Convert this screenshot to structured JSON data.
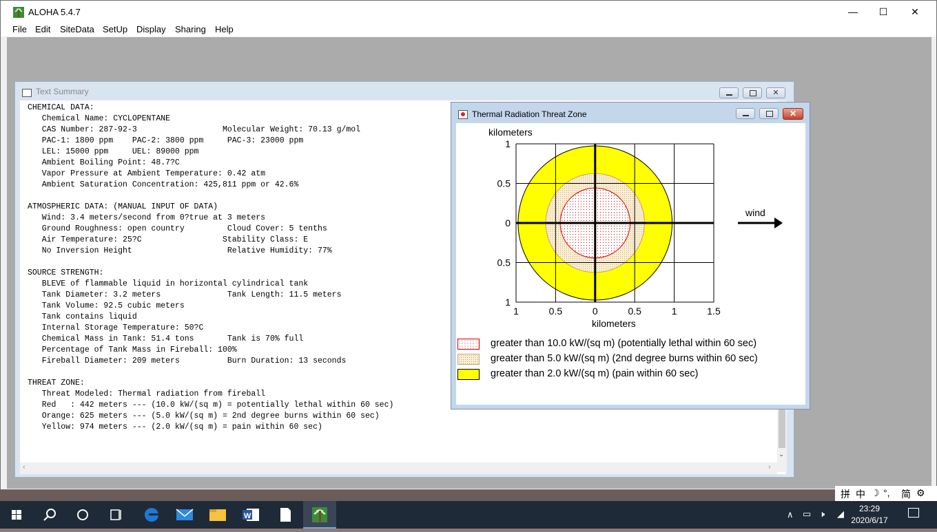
{
  "app": {
    "title": "ALOHA 5.4.7",
    "minimize": "—",
    "maximize": "☐",
    "close": "✕"
  },
  "menu": [
    "File",
    "Edit",
    "SiteData",
    "SetUp",
    "Display",
    "Sharing",
    "Help"
  ],
  "text_summary": {
    "title": "Text Summary",
    "lines": [
      "CHEMICAL DATA:",
      "   Chemical Name: CYCLOPENTANE",
      "   CAS Number: 287-92-3                  Molecular Weight: 70.13 g/mol",
      "   PAC-1: 1800 ppm    PAC-2: 3800 ppm     PAC-3: 23000 ppm",
      "   LEL: 15000 ppm     UEL: 89000 ppm",
      "   Ambient Boiling Point: 48.7?C",
      "   Vapor Pressure at Ambient Temperature: 0.42 atm",
      "   Ambient Saturation Concentration: 425,811 ppm or 42.6%",
      "",
      "ATMOSPHERIC DATA: (MANUAL INPUT OF DATA)",
      "   Wind: 3.4 meters/second from 0?true at 3 meters",
      "   Ground Roughness: open country         Cloud Cover: 5 tenths",
      "   Air Temperature: 25?C                 Stability Class: E",
      "   No Inversion Height                    Relative Humidity: 77%",
      "",
      "SOURCE STRENGTH:",
      "   BLEVE of flammable liquid in horizontal cylindrical tank",
      "   Tank Diameter: 3.2 meters              Tank Length: 11.5 meters",
      "   Tank Volume: 92.5 cubic meters",
      "   Tank contains liquid",
      "   Internal Storage Temperature: 50?C",
      "   Chemical Mass in Tank: 51.4 tons       Tank is 70% full",
      "   Percentage of Tank Mass in Fireball: 100%",
      "   Fireball Diameter: 209 meters          Burn Duration: 13 seconds",
      "",
      "THREAT ZONE:",
      "   Threat Modeled: Thermal radiation from fireball",
      "   Red   : 442 meters --- (10.0 kW/(sq m) = potentially lethal within 60 sec)",
      "   Orange: 625 meters --- (5.0 kW/(sq m) = 2nd degree burns within 60 sec)",
      "   Yellow: 974 meters --- (2.0 kW/(sq m) = pain within 60 sec)"
    ]
  },
  "threat_zone": {
    "title": "Thermal Radiation Threat Zone",
    "wind_label": "wind",
    "colors": {
      "red": "#cc0000",
      "orange_fill": "#f5e9c9",
      "yellow": "#ffff00"
    },
    "legend": [
      {
        "text": "greater than 10.0 kW/(sq m) (potentially lethal within 60 sec)",
        "swatch": "red-dots"
      },
      {
        "text": "greater than 5.0 kW/(sq m) (2nd degree burns within 60 sec)",
        "swatch": "orange-dots"
      },
      {
        "text": "greater than 2.0 kW/(sq m) (pain within 60 sec)",
        "swatch": "yellow"
      }
    ]
  },
  "chart_data": {
    "type": "scatter",
    "title": "",
    "xlabel": "kilometers",
    "ylabel": "kilometers",
    "xlim": [
      -1,
      1.5
    ],
    "ylim": [
      -1,
      1
    ],
    "x_tick_labels": [
      "1",
      "0.5",
      "0",
      "0.5",
      "1",
      "1.5"
    ],
    "y_tick_labels": [
      "1",
      "0.5",
      "0",
      "0.5",
      "1"
    ],
    "grid": true,
    "zones": [
      {
        "name": "Red",
        "radius_km": 0.442
      },
      {
        "name": "Orange",
        "radius_km": 0.625
      },
      {
        "name": "Yellow",
        "radius_km": 0.974
      }
    ]
  },
  "taskbar": {
    "time": "23:29",
    "date": "2020/6/17"
  },
  "ime": [
    "拼",
    "中",
    "☽",
    "°,",
    "简",
    "⚙"
  ]
}
